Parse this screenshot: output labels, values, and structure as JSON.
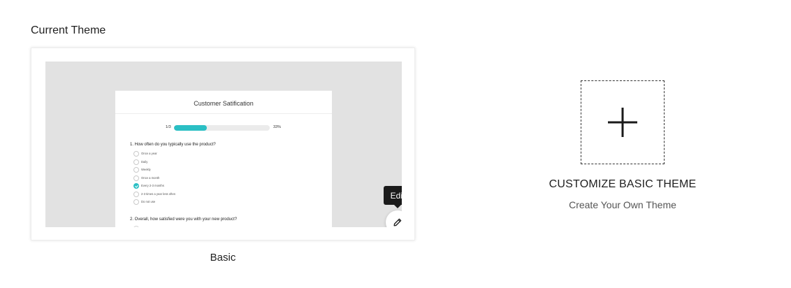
{
  "section_title": "Current Theme",
  "current_theme": {
    "name": "Basic",
    "preview": {
      "survey_title": "Customer Satification",
      "progress": {
        "count_text": "1/3",
        "percent_text": "33%",
        "fraction": 0.34
      },
      "question1": "1. How often do you typically use the product?",
      "options": [
        {
          "label": "Once a year",
          "checked": false
        },
        {
          "label": "Daily",
          "checked": false
        },
        {
          "label": "Weekly",
          "checked": false
        },
        {
          "label": "Once a month",
          "checked": false
        },
        {
          "label": "Every 2-3 months",
          "checked": true
        },
        {
          "label": "2-3 times a year less often",
          "checked": false
        },
        {
          "label": "Do not use",
          "checked": false
        }
      ],
      "question2": "2. Overall, how satisfied were you with your new product?",
      "accent_color": "#2bbfc4"
    },
    "edit_tooltip": "Edit",
    "edit_icon": "pencil-icon"
  },
  "customize": {
    "title": "CUSTOMIZE BASIC THEME",
    "subtitle": "Create Your Own Theme",
    "icon": "plus-icon"
  }
}
